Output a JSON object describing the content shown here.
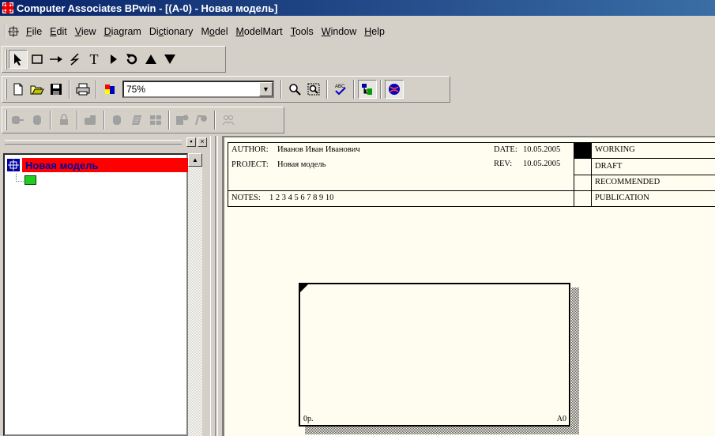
{
  "window": {
    "title": "Computer Associates BPwin - [(A-0)  - Новая модель]",
    "title_color": "#0a246a"
  },
  "menu": [
    {
      "label": "File",
      "icon": "file-menu"
    },
    {
      "label": "Edit"
    },
    {
      "label": "View"
    },
    {
      "label": "Diagram"
    },
    {
      "label": "Dictionary"
    },
    {
      "label": "Model"
    },
    {
      "label": "ModelMart"
    },
    {
      "label": "Tools"
    },
    {
      "label": "Window"
    },
    {
      "label": "Help"
    }
  ],
  "toolbar_tools": [
    "pointer-tool",
    "box-tool",
    "arrow-tool",
    "squiggle-tool",
    "text-tool",
    "go-to-sibling-icon",
    "go-to-parent-icon",
    "go-up-icon",
    "go-down-icon"
  ],
  "toolbar_standard": {
    "zoom_value": "75%"
  },
  "tree": {
    "root_label": "Новая модель",
    "root_color": "#ff0000",
    "child_color": "#22cc22"
  },
  "diagram": {
    "author_label": "AUTHOR:",
    "author_value": "Иванов Иван Иванович",
    "project_label": "PROJECT:",
    "project_value": "Новая модель",
    "date_label": "DATE:",
    "date_value": "10.05.2005",
    "rev_label": "REV:",
    "rev_value": "10.05.2005",
    "notes_label": "NOTES:",
    "notes_value": "1  2  3  4  5  6  7  8  9  10",
    "status": [
      "WORKING",
      "DRAFT",
      "RECOMMENDED",
      "PUBLICATION"
    ],
    "box_cost": "0р.",
    "box_number": "A0"
  }
}
